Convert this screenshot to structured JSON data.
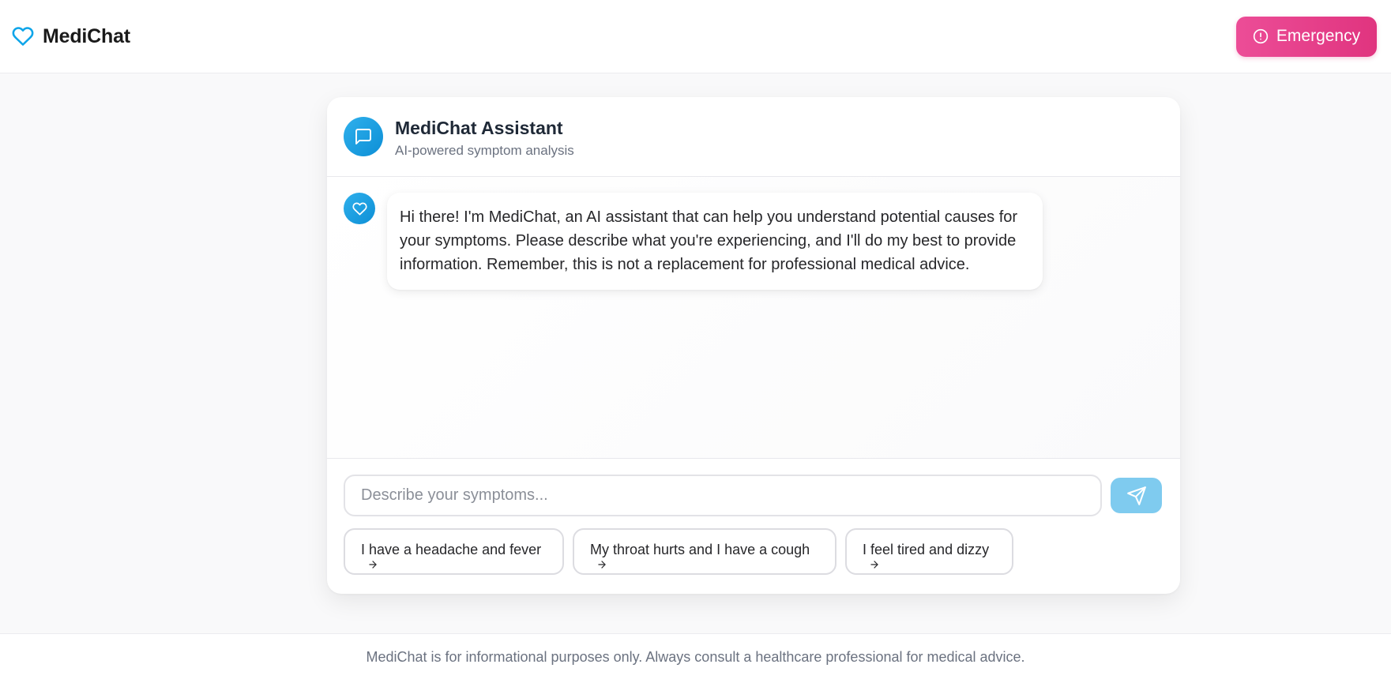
{
  "header": {
    "brand_name": "MediChat",
    "emergency_label": "Emergency"
  },
  "assistant": {
    "title": "MediChat Assistant",
    "subtitle": "AI-powered symptom analysis"
  },
  "messages": [
    {
      "sender": "assistant",
      "text": "Hi there! I'm MediChat, an AI assistant that can help you understand potential causes for your symptoms. Please describe what you're experiencing, and I'll do my best to provide information. Remember, this is not a replacement for professional medical advice."
    }
  ],
  "composer": {
    "placeholder": "Describe your symptoms...",
    "value": ""
  },
  "suggestions": [
    {
      "label": "I have a headache and fever"
    },
    {
      "label": "My throat hurts and I have a cough"
    },
    {
      "label": "I feel tired and dizzy"
    }
  ],
  "footer": {
    "disclaimer": "MediChat is for informational purposes only. Always consult a healthcare professional for medical advice."
  },
  "colors": {
    "brand": "#0ea5e9",
    "emergency": "#e0347f",
    "send_disabled": "#7fcbef"
  },
  "icons": {
    "brand": "heart-outline-icon",
    "emergency": "alert-circle-icon",
    "assistant_header": "message-square-icon",
    "assistant_message": "heart-icon",
    "send": "send-icon",
    "suggestion": "arrow-right-icon"
  }
}
